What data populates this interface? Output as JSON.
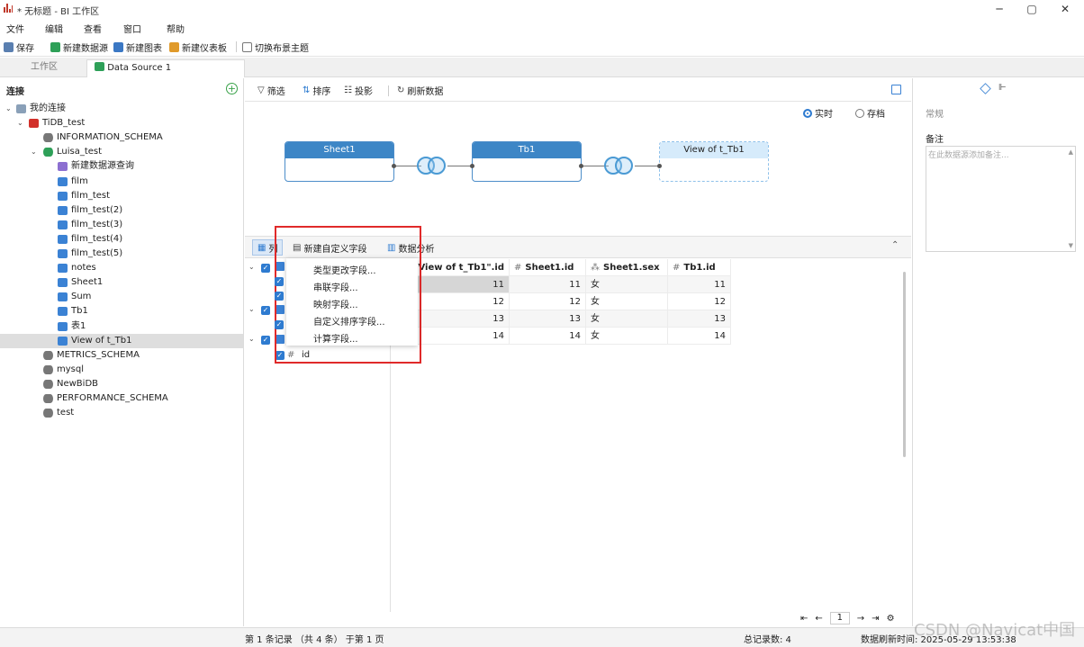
{
  "window": {
    "title": "* 无标题 - BI 工作区",
    "minimize": "─",
    "maximize": "▢",
    "close": "✕"
  },
  "menu": [
    "文件",
    "编辑",
    "查看",
    "窗口",
    "帮助"
  ],
  "toolbar": {
    "save": "保存",
    "new_datasource": "新建数据源",
    "new_chart": "新建图表",
    "new_dashboard": "新建仪表板",
    "switch_theme": "切换布景主题"
  },
  "tabs": {
    "workspace": "工作区",
    "datasource": "Data Source 1"
  },
  "left": {
    "header": "连接",
    "tree": [
      {
        "label": "我的连接",
        "level": 0,
        "arrow": "⌄",
        "icon": "conn"
      },
      {
        "label": "TiDB_test",
        "level": 1,
        "arrow": "⌄",
        "icon": "tidb"
      },
      {
        "label": "INFORMATION_SCHEMA",
        "level": 2,
        "arrow": "",
        "icon": "db-gray"
      },
      {
        "label": "Luisa_test",
        "level": 2,
        "arrow": "⌄",
        "icon": "db-green"
      },
      {
        "label": "新建数据源查询",
        "level": 3,
        "arrow": "",
        "icon": "query"
      },
      {
        "label": "film",
        "level": 3,
        "arrow": "",
        "icon": "table"
      },
      {
        "label": "film_test",
        "level": 3,
        "arrow": "",
        "icon": "table"
      },
      {
        "label": "film_test(2)",
        "level": 3,
        "arrow": "",
        "icon": "table"
      },
      {
        "label": "film_test(3)",
        "level": 3,
        "arrow": "",
        "icon": "table"
      },
      {
        "label": "film_test(4)",
        "level": 3,
        "arrow": "",
        "icon": "table"
      },
      {
        "label": "film_test(5)",
        "level": 3,
        "arrow": "",
        "icon": "table"
      },
      {
        "label": "notes",
        "level": 3,
        "arrow": "",
        "icon": "table"
      },
      {
        "label": "Sheet1",
        "level": 3,
        "arrow": "",
        "icon": "table"
      },
      {
        "label": "Sum",
        "level": 3,
        "arrow": "",
        "icon": "table"
      },
      {
        "label": "Tb1",
        "level": 3,
        "arrow": "",
        "icon": "table"
      },
      {
        "label": "表1",
        "level": 3,
        "arrow": "",
        "icon": "table"
      },
      {
        "label": "View of t_Tb1",
        "level": 3,
        "arrow": "",
        "icon": "view",
        "selected": true
      },
      {
        "label": "METRICS_SCHEMA",
        "level": 2,
        "arrow": "",
        "icon": "db-gray"
      },
      {
        "label": "mysql",
        "level": 2,
        "arrow": "",
        "icon": "db-gray"
      },
      {
        "label": "NewBiDB",
        "level": 2,
        "arrow": "",
        "icon": "db-gray"
      },
      {
        "label": "PERFORMANCE_SCHEMA",
        "level": 2,
        "arrow": "",
        "icon": "db-gray"
      },
      {
        "label": "test",
        "level": 2,
        "arrow": "",
        "icon": "db-gray"
      }
    ]
  },
  "center": {
    "toolbar": {
      "filter": "筛选",
      "sort": "排序",
      "project": "投影",
      "refresh": "刷新数据"
    },
    "mode": {
      "realtime": "实时",
      "archive": "存档",
      "selected": "realtime"
    },
    "nodes": {
      "n1": "Sheet1",
      "n2": "Tb1",
      "n3": "View of t_Tb1"
    },
    "bottom_tabs": {
      "columns": "列",
      "new_custom": "新建自定义字段",
      "analysis": "数据分析"
    },
    "context_menu": [
      "类型更改字段...",
      "串联字段...",
      "映射字段...",
      "自定义排序字段...",
      "计算字段..."
    ],
    "field_visible": {
      "hash": "#",
      "name": "id"
    },
    "grid": {
      "headers": [
        "\"View of t_Tb1\".id",
        "Sheet1.id",
        "Sheet1.sex",
        "Tb1.id"
      ],
      "header_icons": [
        "",
        "#",
        "⁂",
        "#"
      ],
      "rows": [
        [
          "11",
          "11",
          "女",
          "11"
        ],
        [
          "12",
          "12",
          "女",
          "12"
        ],
        [
          "13",
          "13",
          "女",
          "13"
        ],
        [
          "14",
          "14",
          "女",
          "14"
        ]
      ]
    },
    "pager": {
      "first": "⇤",
      "prev": "←",
      "page": "1",
      "next": "→",
      "last": "⇥",
      "gear": "⚙"
    }
  },
  "right": {
    "section": "常规",
    "notes_label": "备注",
    "notes_placeholder": "在此数据源添加备注..."
  },
  "status": {
    "left": "第 1 条记录 （共 4 条） 于第 1 页",
    "total": "总记录数: 4",
    "refresh_time": "数据刷新时间: 2025-05-29 13:53:38",
    "watermark": "CSDN @Navicat中国"
  }
}
